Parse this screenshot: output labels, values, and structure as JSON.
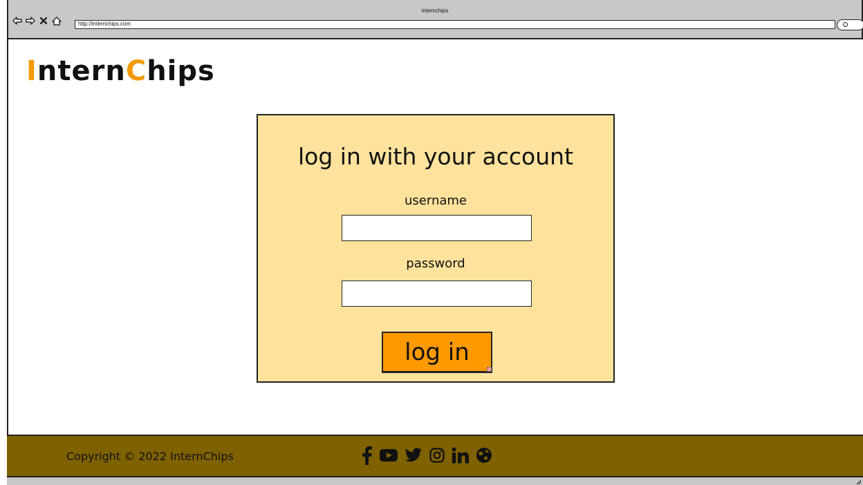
{
  "browser": {
    "window_title": "internchips",
    "url": "http://internchips.com",
    "nav_icons": [
      "back-arrow-icon",
      "forward-arrow-icon",
      "close-icon",
      "home-icon"
    ],
    "search_icon": "search-icon"
  },
  "header": {
    "logo_first_letter": "I",
    "logo_part1": "ntern",
    "logo_accent_letter": "C",
    "logo_part2": "hips",
    "accent_color": "#f39a00"
  },
  "login": {
    "title": "log in with your account",
    "username_label": "username",
    "username_value": "",
    "password_label": "password",
    "password_value": "",
    "button_label": "log in",
    "card_color": "#ffe39c",
    "button_color": "#ff9900"
  },
  "footer": {
    "copyright": "Copyright © 2022 InternChips",
    "background_color": "#7f6100",
    "social_icons": [
      "facebook-icon",
      "youtube-icon",
      "twitter-icon",
      "instagram-icon",
      "linkedin-icon",
      "globe-icon"
    ]
  }
}
